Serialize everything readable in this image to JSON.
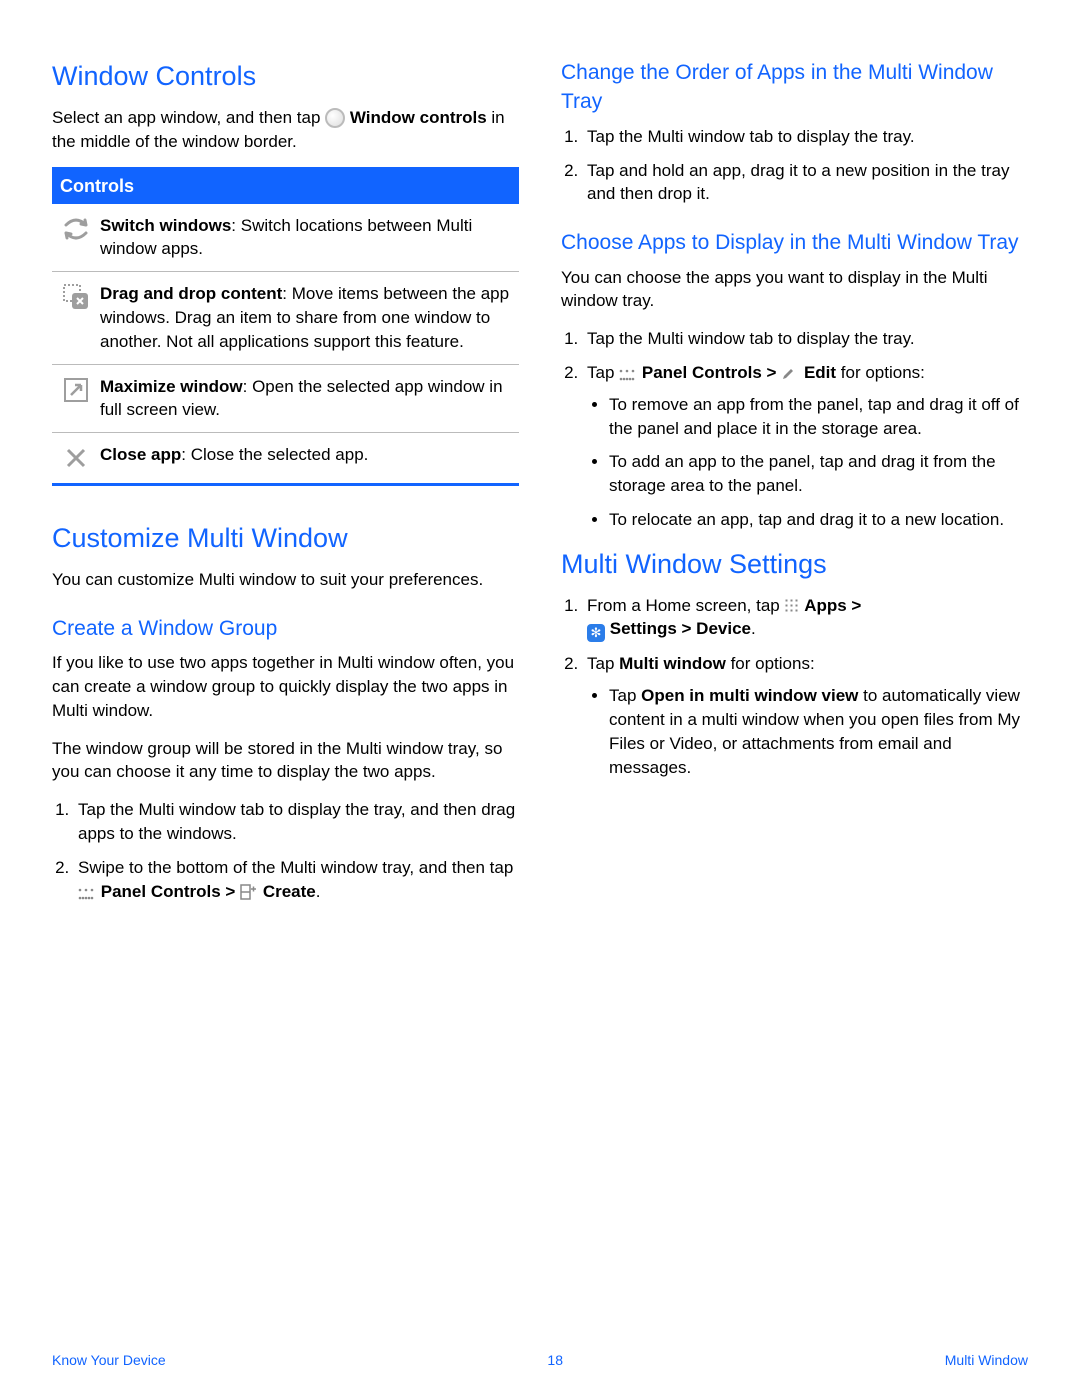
{
  "left": {
    "h_window_controls": "Window Controls",
    "intro_1a": "Select an app window, and then tap ",
    "intro_1b": "Window controls",
    "intro_1c": " in the middle of the window border.",
    "controls_header": "Controls",
    "row1_b": "Switch windows",
    "row1_t": ": Switch locations between Multi window apps.",
    "row2_b": "Drag and drop content",
    "row2_t": ": Move items between the app windows. Drag an item to share from one window to another. Not all applications support this feature.",
    "row3_b": "Maximize window",
    "row3_t": ": Open the selected app window in full screen view.",
    "row4_b": "Close app",
    "row4_t": ": Close the selected app.",
    "h_customize": "Customize Multi Window",
    "customize_p": "You can customize Multi window to suit your preferences.",
    "h_create_group": "Create a Window Group",
    "create_p1": "If you like to use two apps together in Multi window often, you can create a window group to quickly display the two apps in Multi window.",
    "create_p2": "The window group will be stored in the Multi window tray, so you can choose it any time to display the two apps.",
    "create_li1": "Tap the Multi window tab to display the tray, and then drag apps to the windows.",
    "create_li2a": "Swipe to the bottom of the Multi window tray, and then tap ",
    "create_li2b": "Panel Controls > ",
    "create_li2c": "Create",
    "create_li2d": "."
  },
  "right": {
    "h_change_order": "Change the Order of Apps in the Multi Window Tray",
    "order_li1": "Tap the Multi window tab to display the tray.",
    "order_li2": "Tap and hold an app, drag it to a new position in the tray and then drop it.",
    "h_choose_apps": "Choose Apps to Display in the Multi Window Tray",
    "choose_p": "You can choose the apps you want to display in the Multi window tray.",
    "choose_li1": "Tap the Multi window tab to display the tray.",
    "choose_li2a": "Tap ",
    "choose_li2b": "Panel Controls > ",
    "choose_li2c": "Edit",
    "choose_li2d": " for options:",
    "choose_b1": "To remove an app from the panel, tap and drag it off of the panel and place it in the storage area.",
    "choose_b2": "To add an app to the panel, tap and drag it from the storage area to the panel.",
    "choose_b3": "To relocate an app, tap and drag it to a new location.",
    "h_settings": "Multi Window Settings",
    "set_li1a": "From a Home screen, tap ",
    "set_li1b": "Apps > ",
    "set_li1c": "Settings > Device",
    "set_li1d": ".",
    "set_li2a": "Tap ",
    "set_li2b": "Multi window",
    "set_li2c": " for options:",
    "set_b1a": "Tap ",
    "set_b1b": "Open in multi window view",
    "set_b1c": " to automatically view content in a multi window when you open files from My Files or Video, or attachments from email and messages."
  },
  "footer": {
    "left": "Know Your Device",
    "center": "18",
    "right": "Multi Window"
  }
}
